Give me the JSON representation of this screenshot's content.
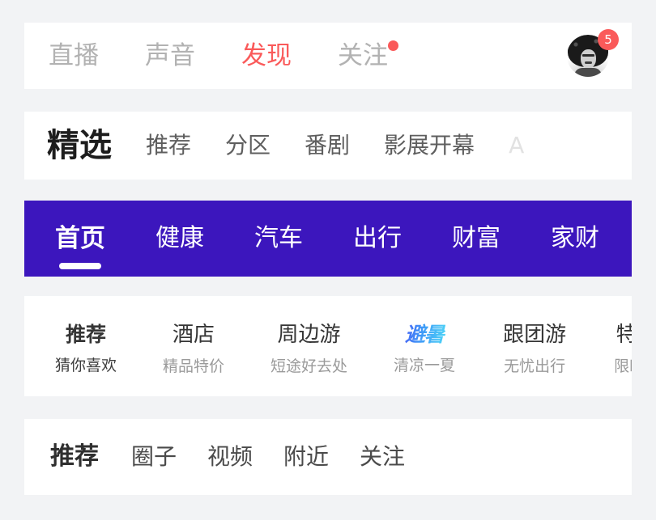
{
  "theme": {
    "page_bg": "#f2f3f5",
    "card_bg": "#ffffff",
    "accent_red": "#fa5a5a",
    "accent_purple": "#3c16bd",
    "accent_yellow": "#ffd02e",
    "accent_blue": "#4a5cf5"
  },
  "top_nav": {
    "items": [
      {
        "label": "直播",
        "active": false,
        "dot": false
      },
      {
        "label": "声音",
        "active": false,
        "dot": false
      },
      {
        "label": "发现",
        "active": true,
        "dot": false
      },
      {
        "label": "关注",
        "active": false,
        "dot": true
      }
    ],
    "avatar": {
      "name": "avatar",
      "badge_count": "5"
    }
  },
  "featured_nav": {
    "active": {
      "label": "精选"
    },
    "items": [
      {
        "label": "推荐",
        "faded": false
      },
      {
        "label": "分区",
        "faded": false
      },
      {
        "label": "番剧",
        "faded": false
      },
      {
        "label": "影展开幕",
        "faded": false
      },
      {
        "label": "A",
        "faded": true
      }
    ]
  },
  "purple_nav": {
    "items": [
      {
        "label": "首页",
        "active": true
      },
      {
        "label": "健康",
        "active": false
      },
      {
        "label": "汽车",
        "active": false
      },
      {
        "label": "出行",
        "active": false
      },
      {
        "label": "财富",
        "active": false
      },
      {
        "label": "家财",
        "active": false
      }
    ]
  },
  "travel_nav": {
    "items": [
      {
        "title": "推荐",
        "subtitle": "猜你喜欢",
        "active": true,
        "logo": false
      },
      {
        "title": "酒店",
        "subtitle": "精品特价",
        "active": false,
        "logo": false
      },
      {
        "title": "周边游",
        "subtitle": "短途好去处",
        "active": false,
        "logo": false
      },
      {
        "title": "避暑",
        "subtitle": "清凉一夏",
        "active": false,
        "logo": true
      },
      {
        "title": "跟团游",
        "subtitle": "无忧出行",
        "active": false,
        "logo": false
      },
      {
        "title": "特价",
        "subtitle": "限时优",
        "active": false,
        "logo": false
      }
    ]
  },
  "bottom_nav": {
    "active": {
      "label": "推荐"
    },
    "items": [
      {
        "label": "圈子"
      },
      {
        "label": "视频"
      },
      {
        "label": "附近"
      },
      {
        "label": "关注"
      }
    ]
  }
}
